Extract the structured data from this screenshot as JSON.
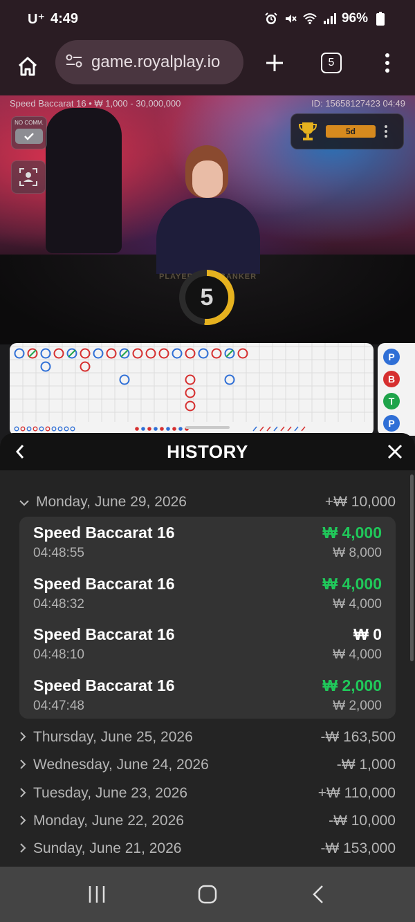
{
  "status_bar": {
    "carrier": "U⁺",
    "time": "4:49",
    "battery": "96%",
    "icons": [
      "alarm-icon",
      "mute-icon",
      "wifi-icon",
      "signal-icon",
      "battery-icon"
    ]
  },
  "browser": {
    "url": "game.royalplay.io",
    "tab_count": "5",
    "icons": [
      "home-icon",
      "site-settings-icon",
      "new-tab-icon",
      "tabs-icon",
      "more-icon"
    ]
  },
  "video": {
    "table_info": "Speed Baccarat 16 • ₩ 1,000 - 30,000,000",
    "round_id": "ID: 15658127423 04:49",
    "no_comm_label": "NO COMM.",
    "trophy_label": "5d",
    "timer": "5",
    "player_label": "PLAYER",
    "banker_label": "BANKER"
  },
  "bead_road": {
    "beads": [
      {
        "letter": "P",
        "color": "#2f6fd6"
      },
      {
        "letter": "B",
        "color": "#d62f2f"
      },
      {
        "letter": "T",
        "color": "#1ea34a"
      },
      {
        "letter": "P",
        "color": "#2f6fd6"
      },
      {
        "letter": "P",
        "color": "#2f6fd6"
      }
    ]
  },
  "colors": {
    "win_green": "#20c85a",
    "panel_bg": "#242424",
    "card_bg": "#333333",
    "accent_gold": "#e6b21f",
    "player_blue": "#2f6fd6",
    "banker_red": "#d62f2f",
    "tie_green": "#1ea34a"
  },
  "history": {
    "title": "HISTORY",
    "days": [
      {
        "date": "Monday, June 29, 2026",
        "total": "+₩ 10,000",
        "expanded": true,
        "bets": [
          {
            "game": "Speed Baccarat 16",
            "time": "04:48:55",
            "win": "₩ 4,000",
            "stake": "₩ 8,000",
            "win_positive": true
          },
          {
            "game": "Speed Baccarat 16",
            "time": "04:48:32",
            "win": "₩ 4,000",
            "stake": "₩ 4,000",
            "win_positive": true
          },
          {
            "game": "Speed Baccarat 16",
            "time": "04:48:10",
            "win": "₩ 0",
            "stake": "₩ 4,000",
            "win_positive": false
          },
          {
            "game": "Speed Baccarat 16",
            "time": "04:47:48",
            "win": "₩ 2,000",
            "stake": "₩ 2,000",
            "win_positive": true
          }
        ]
      },
      {
        "date": "Thursday, June 25, 2026",
        "total": "-₩ 163,500",
        "expanded": false
      },
      {
        "date": "Wednesday, June 24, 2026",
        "total": "-₩ 1,000",
        "expanded": false
      },
      {
        "date": "Tuesday, June 23, 2026",
        "total": "+₩ 110,000",
        "expanded": false
      },
      {
        "date": "Monday, June 22, 2026",
        "total": "-₩ 10,000",
        "expanded": false
      },
      {
        "date": "Sunday, June 21, 2026",
        "total": "-₩ 153,000",
        "expanded": false
      }
    ]
  },
  "nav_bar": {
    "icons": [
      "recent-apps-icon",
      "home-nav-icon",
      "back-nav-icon"
    ]
  }
}
